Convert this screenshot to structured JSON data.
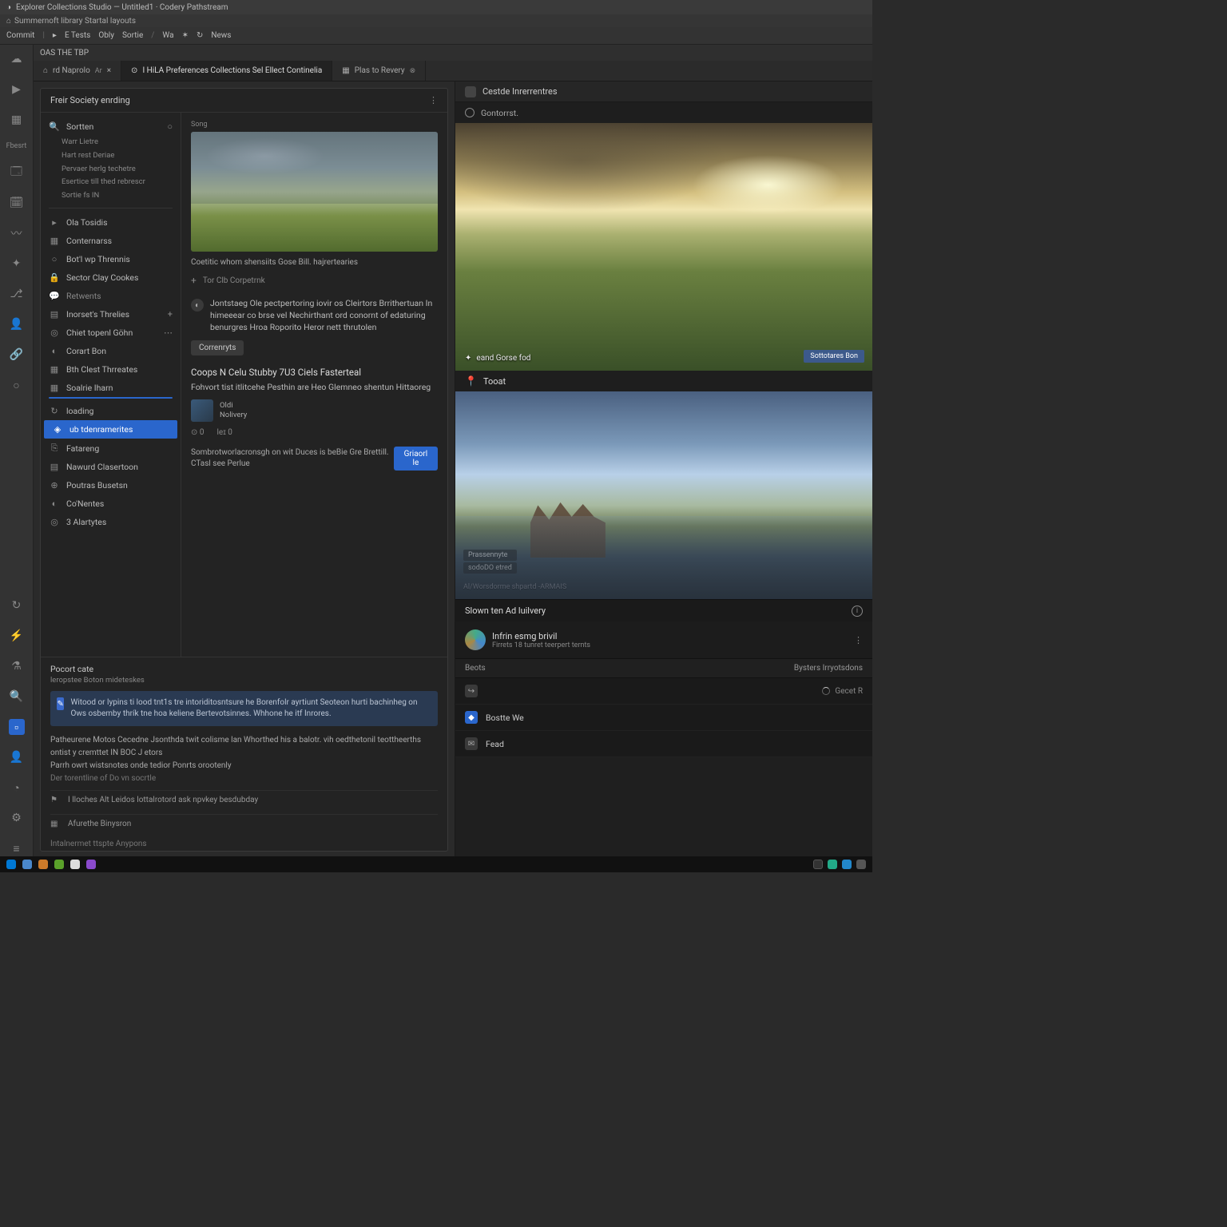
{
  "titlebar": {
    "app_icon": "◑",
    "title": "Explorer Collections Studio — Untitled1 · Codery Pathstream"
  },
  "menubar": {
    "prefix_icon": "⌂",
    "text": "Summernoft library Startal layouts"
  },
  "toolbar": {
    "items": [
      "Commit",
      "▸",
      "E Tests",
      "Obly",
      "Sortie",
      "Wa",
      "✶",
      "↻",
      "News"
    ]
  },
  "outer_tabs": {
    "label": "OAS THE TBP"
  },
  "tabs": [
    {
      "icon": "⌂",
      "label": "rd Naprolo",
      "pill": "Ar",
      "xbtn": "×",
      "active": false
    },
    {
      "icon": "⊙",
      "label": "I HiLA Preferences Collections Sel Ellect Continelia",
      "pill": "",
      "xbtn": "",
      "active": true
    },
    {
      "icon": "▦",
      "label": "Plas to Revery",
      "pill": "⊗",
      "xbtn": "",
      "active": false
    }
  ],
  "left_panel": {
    "title": "Freir Society enrding",
    "nav": {
      "head": {
        "icon": "🔍",
        "label": "Sortten",
        "sublines": [
          "Warr Lietre",
          "Hart rest Deriae",
          "Pervaer herlg techetre",
          "Esertice till thed rebrescr",
          "Sortie fs IN"
        ],
        "nodot": "○"
      },
      "items": [
        {
          "icon": "▸",
          "label": "Ola Tosidis"
        },
        {
          "icon": "▦",
          "label": "Conternarss"
        },
        {
          "icon": "○",
          "label": "Bot'l wp Thrennis"
        },
        {
          "icon": "🔒",
          "label": "Sector Clay Cookes"
        },
        {
          "icon": "💬",
          "label": "Retwents",
          "dim": true
        },
        {
          "icon": "▤",
          "label": "Inorset's Threlies",
          "extra": "+"
        },
        {
          "icon": "◎",
          "label": "Chiet topenl Göhn",
          "extra": "⋯"
        },
        {
          "icon": "◐",
          "label": "Corart Bon"
        },
        {
          "icon": "▦",
          "label": "Bth Clest Thrreates"
        },
        {
          "icon": "▦",
          "label": "Soalrie Iharn"
        },
        {
          "icon": "↻",
          "label": "loading",
          "progress": true
        },
        {
          "icon": "◈",
          "label": "ub tdenramerites",
          "selected": true
        },
        {
          "icon": "⎘",
          "label": "Fatareng"
        },
        {
          "icon": "▤",
          "label": "Nawurd Clasertoon"
        },
        {
          "icon": "⊕",
          "label": "Poutras Busetsn"
        },
        {
          "icon": "◐",
          "label": "Co'Nentes"
        },
        {
          "icon": "◎",
          "label": "3 Alartytes"
        }
      ]
    },
    "detail": {
      "small_label": "Song",
      "caption": "Coetitic whom shensiits Gose Bill. hajrertearies",
      "sep_label": "Tor Clb Corpetrnk",
      "block1": {
        "text": "Jontstaeg Ole pectpertoring iovir os Cleirtors Brrithertuan In himeeear co brse vel Nechirthant ord conornt of edaturing benurgres Hroa Roporito Heror nett thrutolen",
        "button": "Correnryts"
      },
      "block2": {
        "title": "Coops N Celu Stubby 7U3 Ciels Fasterteal",
        "text": "Fohvort tist itlitcehe Pesthin are Heo Glemneo shentun Hittaoreg",
        "avatar_line1": "Oldi",
        "avatar_line2": "Nolivery",
        "stats": {
          "a": "⊙ 0",
          "b": "leɪ 0"
        },
        "footer": "Sombrotworlacronsgh on wit Duces is beBie Gre Brettill. CTasl see Perlue",
        "action": "Griaorl le"
      }
    },
    "console": {
      "title": "Pocort cate",
      "subtitle": "leropstee Boton mideteskes",
      "banner": "Witood or lypins ti lood tnt1s tre intoriditosntsure he Borenfolr ayrtiunt Seoteon hurti bachinheg on Ows osbemby thrík tne hoa keliene Bertevotsinnes. Whhone he itf Inrores.",
      "lines": [
        "Patheurene Motos Cecedne Jsonthda twit colisme lan Whorthed his a balotr. vih oedthetonil teottheerths ontist y cremttet IN BOC J etors",
        "Parrh owrt wistsnotes onde tedior Ponrts orootenly",
        "Der torentline of Do vn socrtle"
      ],
      "rows": [
        {
          "icon": "⚑",
          "label": "I lloches Alt Leidos lottalrotord ask npvkey besdubday"
        },
        {
          "icon": "▦",
          "label": "Afurethe Binysron"
        }
      ],
      "tail": "Intalnermet ttspte Anypons"
    }
  },
  "right_panel": {
    "header": {
      "label": "Cestde Inrerrentres"
    },
    "sub": {
      "label": "Gontorrst."
    },
    "img1": {
      "caption": "eand Gorse fod",
      "badge": "Sottotares Bon"
    },
    "img2": {
      "header": "Tooat",
      "tag1": "Prassennyte",
      "tag2": "sodoDO etred",
      "path": "Al/Worsdorme shpartd -ARMAIS"
    },
    "midbar": {
      "label": "Slown ten Ad luilvery"
    },
    "profile": {
      "name": "Infrin esmg brivil",
      "sub": "Firrets 18 tunret teerpert ternts"
    },
    "table": {
      "colA": "Beots",
      "colB": "Bysters Irryotsdons"
    },
    "rows": [
      {
        "icon": "↪",
        "icon_class": "ic-gray",
        "label": "",
        "right": "Gecet R",
        "spin": true
      },
      {
        "icon": "◆",
        "icon_class": "ic-blue",
        "label": "Bostte We",
        "right": ""
      },
      {
        "icon": "✉",
        "icon_class": "ic-gray",
        "label": "Fead",
        "right": ""
      }
    ]
  }
}
